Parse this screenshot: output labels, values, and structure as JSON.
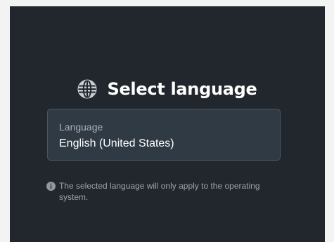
{
  "dialog": {
    "title": "Select language",
    "title_icon": "globe-icon"
  },
  "language_field": {
    "label": "Language",
    "value": "English (United States)"
  },
  "note": {
    "icon": "info-icon",
    "text": "The selected language will only apply to the operating system."
  },
  "colors": {
    "panel_background": "#22272d",
    "field_background": "#2f3a44",
    "field_border": "#4b5661",
    "title_text": "#ffffff",
    "muted_text": "#a9b1ba"
  }
}
